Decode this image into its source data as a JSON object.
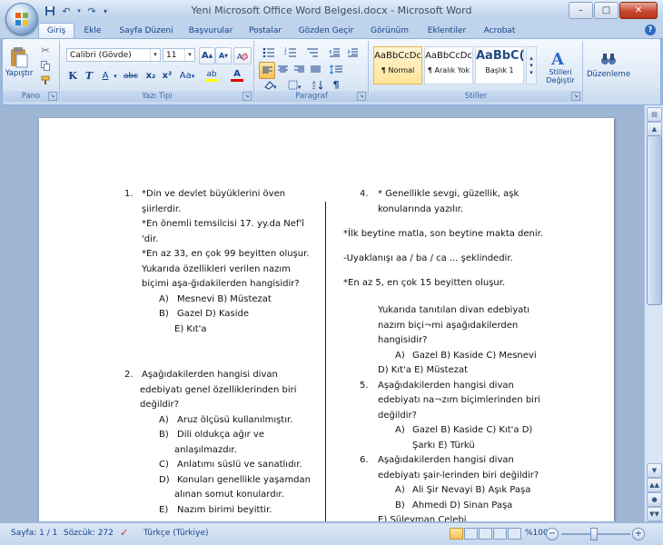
{
  "window": {
    "title": "Yeni Microsoft Office Word Belgesi.docx - Microsoft Word",
    "controls": {
      "minimize": "–",
      "maximize": "□",
      "close": "✕"
    }
  },
  "qat": {
    "save_icon": "save-icon",
    "undo_icon": "undo-icon",
    "redo_icon": "redo-icon",
    "customize": "▾"
  },
  "tabs": [
    "Giriş",
    "Ekle",
    "Sayfa Düzeni",
    "Başvurular",
    "Postalar",
    "Gözden Geçir",
    "Görünüm",
    "Eklentiler",
    "Acrobat"
  ],
  "ribbon": {
    "clipboard": {
      "label": "Pano",
      "paste": "Yapıştır"
    },
    "font": {
      "label": "Yazı Tipi",
      "font_name": "Calibri (Gövde)",
      "font_size": "11",
      "bold": "K",
      "italic": "T",
      "underline": "A",
      "strike": "abc",
      "subscript": "x₂",
      "superscript": "x²",
      "change_case": "Aa",
      "grow": "A",
      "shrink": "A",
      "highlight": "ab",
      "font_color": "A",
      "highlight_color": "#ffff00",
      "font_color_value": "#e00000"
    },
    "paragraph": {
      "label": "Paragraf"
    },
    "styles": {
      "label": "Stiller",
      "items": [
        {
          "sample": "AaBbCcDc",
          "name": "¶ Normal"
        },
        {
          "sample": "AaBbCcDc",
          "name": "¶ Aralık Yok"
        },
        {
          "sample": "AaBbC(",
          "name": "Başlık 1"
        }
      ],
      "change": "Stilleri Değiştir"
    },
    "editing": {
      "label": "Düzenleme"
    }
  },
  "document": {
    "left": [
      {
        "type": "num",
        "num": "1.",
        "text": "*Din ve devlet büyüklerini öven"
      },
      {
        "type": "line",
        "text": "şiirlerdir."
      },
      {
        "type": "line",
        "text": "*En önemli temsilcisi 17. yy.da Nef'î"
      },
      {
        "type": "line",
        "text": "'dir."
      },
      {
        "type": "line",
        "text": "*En az 33, en çok 99 beyitten oluşur."
      },
      {
        "type": "line",
        "text": "Yukarıda özellikleri verilen nazım"
      },
      {
        "type": "line",
        "text": "biçimi aşa-ğıdakilerden hangisidir?"
      },
      {
        "type": "opt",
        "mark": "A)",
        "text": "Mesnevi B) Müstezat"
      },
      {
        "type": "opt",
        "mark": "B)",
        "text": "Gazel D) Kaside"
      },
      {
        "type": "opt2",
        "text": "E) Kıt'a"
      },
      {
        "type": "num",
        "num": "2.",
        "text": "Aşağıdakilerden hangisi divan"
      },
      {
        "type": "line2",
        "text": "edebiyatı genel özelliklerinden biri"
      },
      {
        "type": "line2",
        "text": "değildir?"
      },
      {
        "type": "opt",
        "mark": "A)",
        "text": "Aruz ölçüsü kullanılmıştır."
      },
      {
        "type": "opt",
        "mark": "B)",
        "text": "Dili oldukça ağır ve"
      },
      {
        "type": "opt2",
        "text": "anlaşılmazdır."
      },
      {
        "type": "opt",
        "mark": "C)",
        "text": "Anlatımı süslü ve sanatlıdır."
      },
      {
        "type": "opt",
        "mark": "D)",
        "text": "Konuları genellikle yaşamdan"
      },
      {
        "type": "opt2",
        "text": "alınan somut konulardır."
      },
      {
        "type": "opt",
        "mark": "E)",
        "text": "Nazım birimi beyittir."
      }
    ],
    "right": [
      {
        "type": "num",
        "num": "4.",
        "text": "* Genellikle sevgi, güzellik, aşk"
      },
      {
        "type": "ind",
        "text": "konularında yazılır."
      },
      {
        "type": "plain",
        "text": "*İlk beytine matla, son beytine makta denir."
      },
      {
        "type": "plain",
        "text": "-Uyaklanışı aa / ba / ca ... şeklindedir."
      },
      {
        "type": "plain",
        "text": "*En az 5, en çok 15  beyitten oluşur."
      },
      {
        "type": "ind",
        "text": "Yukarıda tanıtılan  divan edebiyatı"
      },
      {
        "type": "ind",
        "text": "nazım biçi¬mi aşağıdakilerden"
      },
      {
        "type": "ind",
        "text": "hangisidir?"
      },
      {
        "type": "opt",
        "mark": "A)",
        "text": "Gazel B) Kaside C) Mesnevi"
      },
      {
        "type": "ind",
        "text": "D) Kıt'a E) Müstezat"
      },
      {
        "type": "num",
        "num": "5.",
        "text": "Aşağıdakilerden hangisi divan"
      },
      {
        "type": "ind",
        "text": "edebiyatı na¬zım biçimlerinden biri"
      },
      {
        "type": "ind",
        "text": "değildir?"
      },
      {
        "type": "opt",
        "mark": "A)",
        "text": "Gazel B) Kaside C) Kıt'a D)"
      },
      {
        "type": "ind2",
        "text": "Şarkı E) Türkü"
      },
      {
        "type": "num",
        "num": "6.",
        "text": "Aşağıdakilerden hangisi divan"
      },
      {
        "type": "ind",
        "text": "edebiyatı şair-lerinden biri değildir?"
      },
      {
        "type": "opt",
        "mark": "A)",
        "text": "Ali Şir Nevayi B) Aşık Paşa"
      },
      {
        "type": "opt",
        "mark": "B)",
        "text": "Ahmedi D) Sinan Paşa"
      },
      {
        "type": "plain2",
        "text": "E) Süleyman Çelebi"
      }
    ]
  },
  "status": {
    "page": "Sayfa: 1 / 1",
    "words": "Sözcük: 272",
    "language": "Türkçe (Türkiye)",
    "zoom": "%100",
    "zoom_level": 100
  }
}
